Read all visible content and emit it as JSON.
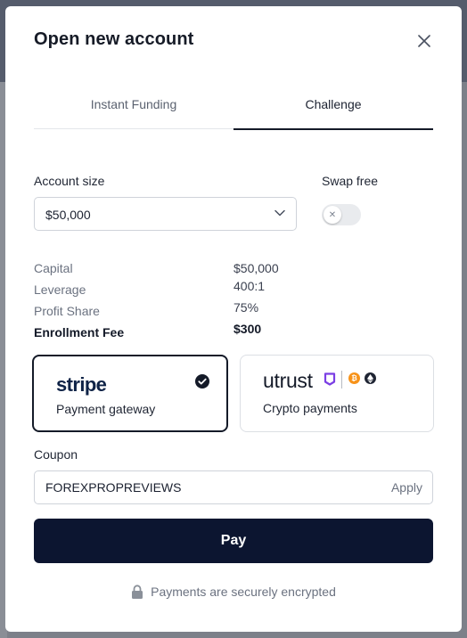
{
  "modal": {
    "title": "Open new account"
  },
  "tabs": [
    {
      "label": "Instant Funding",
      "active": false
    },
    {
      "label": "Challenge",
      "active": true
    }
  ],
  "account_size": {
    "label": "Account size",
    "selected": "$50,000"
  },
  "swap_free": {
    "label": "Swap free",
    "enabled": false
  },
  "details": [
    {
      "label": "Capital",
      "value": "$50,000"
    },
    {
      "label": "Leverage",
      "value": "400:1"
    },
    {
      "label": "Profit Share",
      "value": "75%"
    },
    {
      "label": "Enrollment Fee",
      "value": "$300"
    }
  ],
  "payment_options": {
    "stripe": {
      "logo": "stripe",
      "label": "Payment gateway",
      "selected": true
    },
    "utrust": {
      "logo": "utrust",
      "label": "Crypto payments",
      "selected": false
    }
  },
  "coupon": {
    "label": "Coupon",
    "value": "FOREXPROPREVIEWS",
    "apply_label": "Apply"
  },
  "pay_button": "Pay",
  "secure_note": "Payments are securely encrypted",
  "colors": {
    "primary": "#0c1530",
    "stripe_brand": "#0f2347",
    "utrust_accent": "#7b3fe4",
    "bitcoin": "#f7931a"
  },
  "icons": [
    "close-icon",
    "chevron-down-icon",
    "check-circle-icon",
    "lock-icon",
    "bitcoin-icon",
    "ethereum-icon"
  ]
}
